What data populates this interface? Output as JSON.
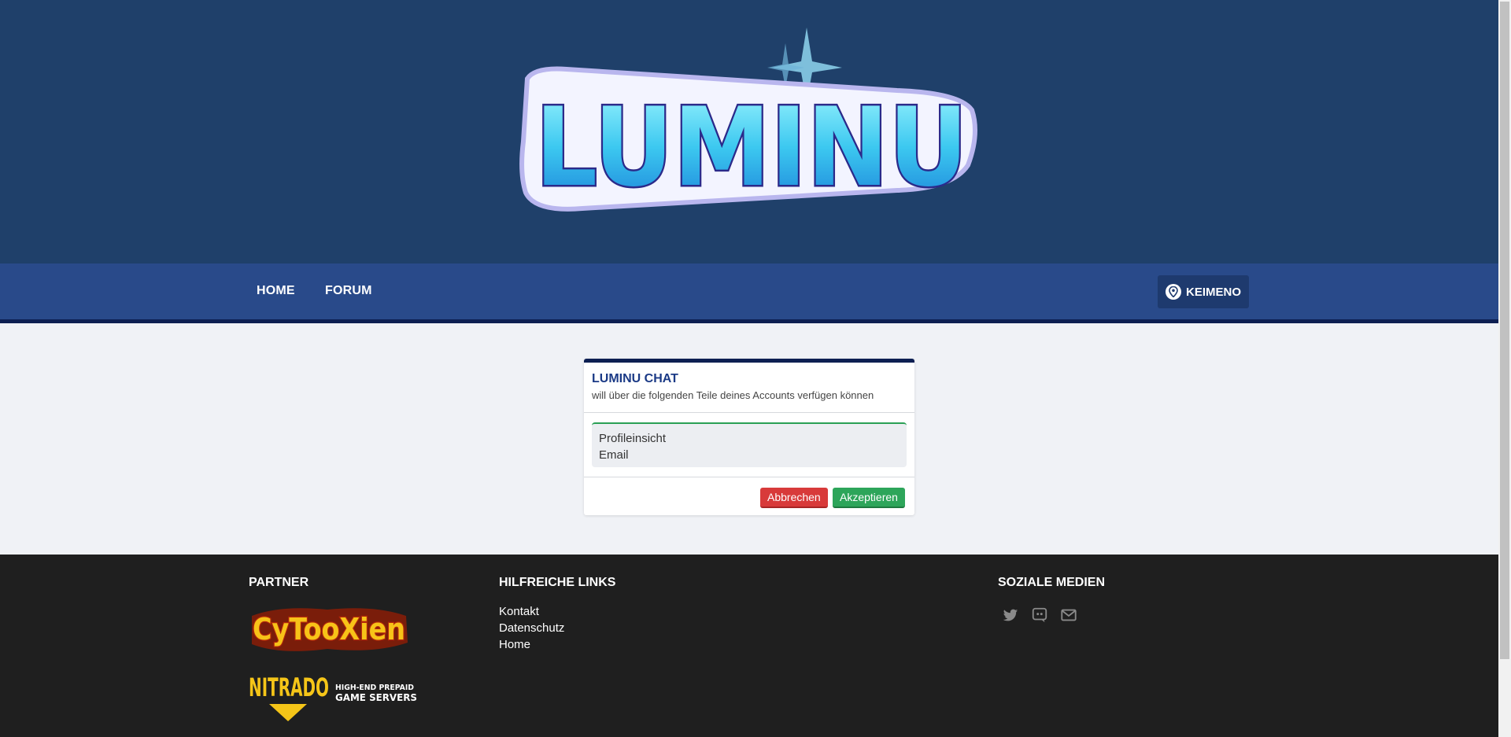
{
  "header": {
    "logo_text": "LUMINU"
  },
  "nav": {
    "home": "HOME",
    "forum": "FORUM",
    "user": "KEIMENO"
  },
  "auth_card": {
    "title": "LUMINU CHAT",
    "subtitle": "will über die folgenden Teile deines Accounts verfügen können",
    "permissions": [
      "Profileinsicht",
      "Email"
    ],
    "cancel_label": "Abbrechen",
    "accept_label": "Akzeptieren"
  },
  "footer": {
    "partner_heading": "PARTNER",
    "links_heading": "HILFREICHE LINKS",
    "social_heading": "SOZIALE MEDIEN",
    "links": [
      "Kontakt",
      "Datenschutz",
      "Home"
    ],
    "partners": {
      "cytooxien": "CyTooXien",
      "nitrado": "NITRADO",
      "nitrado_tag_1": "HIGH-END PREPAID",
      "nitrado_tag_2": "GAME SERVERS"
    },
    "social_icons": [
      "twitter-icon",
      "discord-icon",
      "mail-icon"
    ]
  },
  "colors": {
    "banner": "#1f406a",
    "nav": "#294a8a",
    "accent_dark": "#0d1f52",
    "cancel": "#d83a3a",
    "accept": "#2da55a",
    "footer": "#1f1f1f"
  }
}
